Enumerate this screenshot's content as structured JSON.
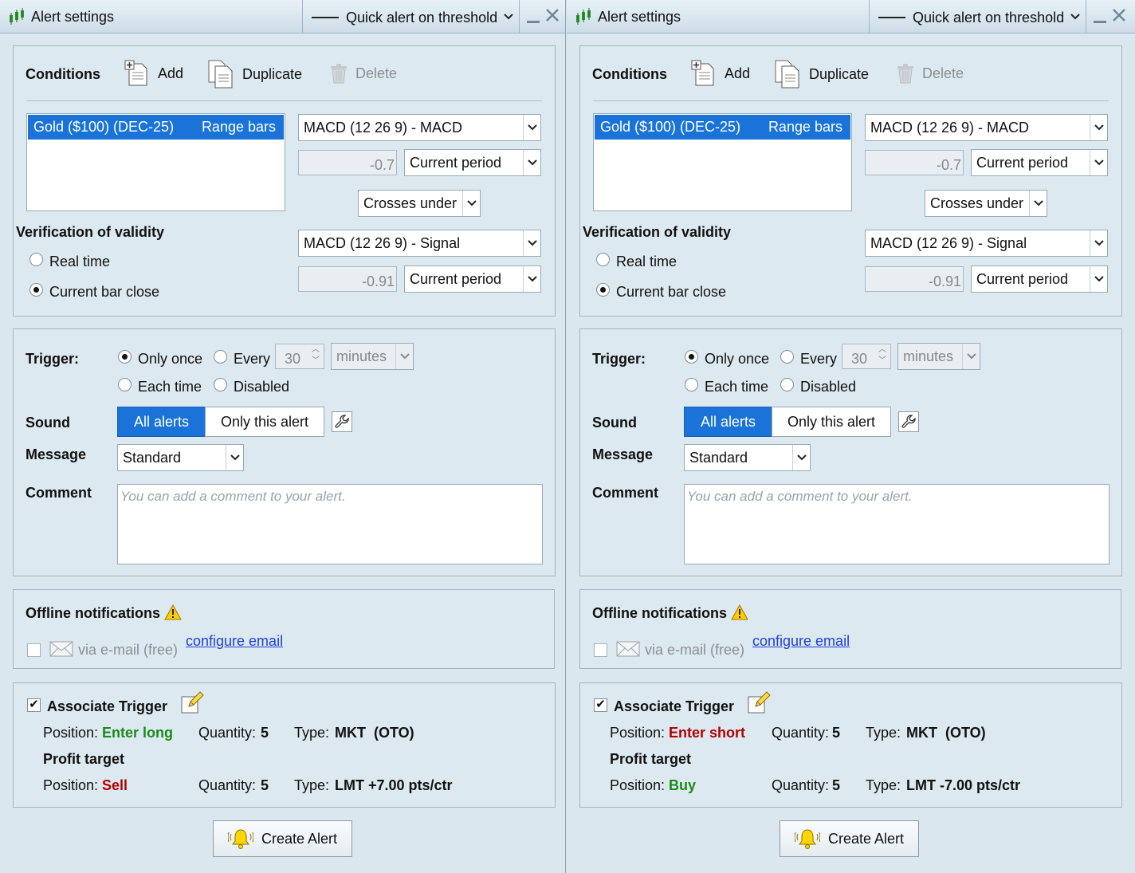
{
  "windows": [
    {
      "title": "Alert settings",
      "alert_type": "Quick alert on threshold",
      "conditions": {
        "heading": "Conditions",
        "add": "Add",
        "duplicate": "Duplicate",
        "delete": "Delete",
        "instrument": "Gold ($100) (DEC-25)",
        "chart_type": "Range bars",
        "indicator1": "MACD (12 26 9)  - MACD",
        "value1": "-0.7",
        "period1": "Current period",
        "operator": "Crosses under",
        "indicator2": "MACD (12 26 9)  - Signal",
        "value2": "-0.91",
        "period2": "Current period",
        "verification_heading": "Verification of validity",
        "real_time": "Real time",
        "bar_close": "Current bar close"
      },
      "trigger": {
        "label": "Trigger:",
        "only_once": "Only once",
        "every": "Every",
        "every_value": "30",
        "every_unit": "minutes",
        "each_time": "Each time",
        "disabled": "Disabled",
        "sound_label": "Sound",
        "sound_all": "All alerts",
        "sound_this": "Only this alert",
        "message_label": "Message",
        "message_value": "Standard",
        "comment_label": "Comment",
        "comment_placeholder": "You can add a comment to your alert."
      },
      "offline": {
        "heading": "Offline notifications",
        "email": "via e-mail (free)",
        "configure": "configure email"
      },
      "associate": {
        "heading": "Associate Trigger",
        "position_label": "Position:",
        "position_value": "Enter long",
        "quantity_label": "Quantity:",
        "quantity_value": "5",
        "type_label": "Type:",
        "type_value": "MKT  (OTO)",
        "profit_heading": "Profit target",
        "pt_position_label": "Position:",
        "pt_position_value": "Sell",
        "pt_quantity_label": "Quantity:",
        "pt_quantity_value": "5",
        "pt_type_label": "Type:",
        "pt_type_value": "LMT +7.00 pts/ctr"
      },
      "create_button": "Create Alert"
    },
    {
      "title": "Alert settings",
      "alert_type": "Quick alert on threshold",
      "conditions": {
        "heading": "Conditions",
        "add": "Add",
        "duplicate": "Duplicate",
        "delete": "Delete",
        "instrument": "Gold ($100) (DEC-25)",
        "chart_type": "Range bars",
        "indicator1": "MACD (12 26 9)  - MACD",
        "value1": "-0.7",
        "period1": "Current period",
        "operator": "Crosses under",
        "indicator2": "MACD (12 26 9)  - Signal",
        "value2": "-0.91",
        "period2": "Current period",
        "verification_heading": "Verification of validity",
        "real_time": "Real time",
        "bar_close": "Current bar close"
      },
      "trigger": {
        "label": "Trigger:",
        "only_once": "Only once",
        "every": "Every",
        "every_value": "30",
        "every_unit": "minutes",
        "each_time": "Each time",
        "disabled": "Disabled",
        "sound_label": "Sound",
        "sound_all": "All alerts",
        "sound_this": "Only this alert",
        "message_label": "Message",
        "message_value": "Standard",
        "comment_label": "Comment",
        "comment_placeholder": "You can add a comment to your alert."
      },
      "offline": {
        "heading": "Offline notifications",
        "email": "via e-mail (free)",
        "configure": "configure email"
      },
      "associate": {
        "heading": "Associate Trigger",
        "position_label": "Position:",
        "position_value": "Enter short",
        "quantity_label": "Quantity:",
        "quantity_value": "5",
        "type_label": "Type:",
        "type_value": "MKT  (OTO)",
        "profit_heading": "Profit target",
        "pt_position_label": "Position:",
        "pt_position_value": "Buy",
        "pt_quantity_label": "Quantity:",
        "pt_quantity_value": "5",
        "pt_type_label": "Type:",
        "pt_type_value": "LMT -7.00 pts/ctr"
      },
      "create_button": "Create Alert"
    }
  ],
  "colors": {
    "selection": "#1a73d9",
    "enter_long": "#1a8a1a",
    "sell": "#b40000",
    "enter_short": "#b40000",
    "buy": "#1a8a1a",
    "link": "#1f3fe0"
  },
  "icons": [
    "chart-icon",
    "add-doc-icon",
    "duplicate-icon",
    "trash-icon",
    "warning-icon",
    "mail-icon",
    "wrench-icon",
    "pencil-icon",
    "bell-icon"
  ]
}
